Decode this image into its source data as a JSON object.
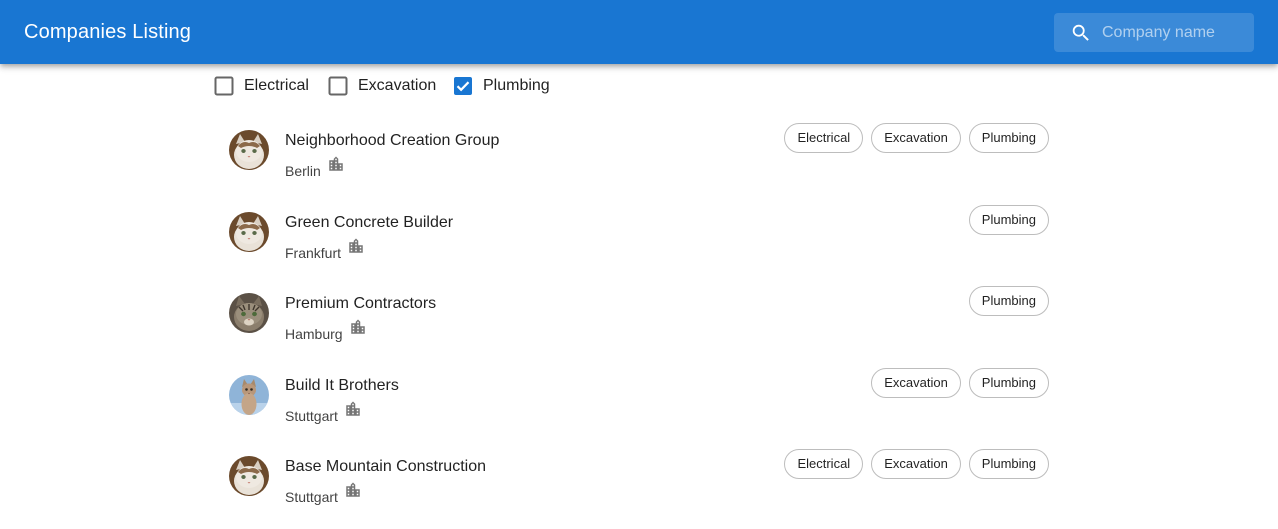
{
  "app": {
    "title": "Companies Listing",
    "search_placeholder": "Company name",
    "search_value": "",
    "accent_color": "#1976d2"
  },
  "filters": [
    {
      "label": "Electrical",
      "checked": false
    },
    {
      "label": "Excavation",
      "checked": false
    },
    {
      "label": "Plumbing",
      "checked": true
    }
  ],
  "companies": [
    {
      "name": "Neighborhood Creation Group",
      "city": "Berlin",
      "avatar": "cat-white-brown",
      "specialties": [
        "Electrical",
        "Excavation",
        "Plumbing"
      ]
    },
    {
      "name": "Green Concrete Builder",
      "city": "Frankfurt",
      "avatar": "cat-white-brown",
      "specialties": [
        "Plumbing"
      ]
    },
    {
      "name": "Premium Contractors",
      "city": "Hamburg",
      "avatar": "cat-tabby",
      "specialties": [
        "Plumbing"
      ]
    },
    {
      "name": "Build It Brothers",
      "city": "Stuttgart",
      "avatar": "cat-kitten-blue-bg",
      "specialties": [
        "Excavation",
        "Plumbing"
      ]
    },
    {
      "name": "Base Mountain Construction",
      "city": "Stuttgart",
      "avatar": "cat-white-brown",
      "specialties": [
        "Electrical",
        "Excavation",
        "Plumbing"
      ]
    }
  ],
  "icons": {
    "search": "search-icon",
    "city": "building-icon"
  }
}
